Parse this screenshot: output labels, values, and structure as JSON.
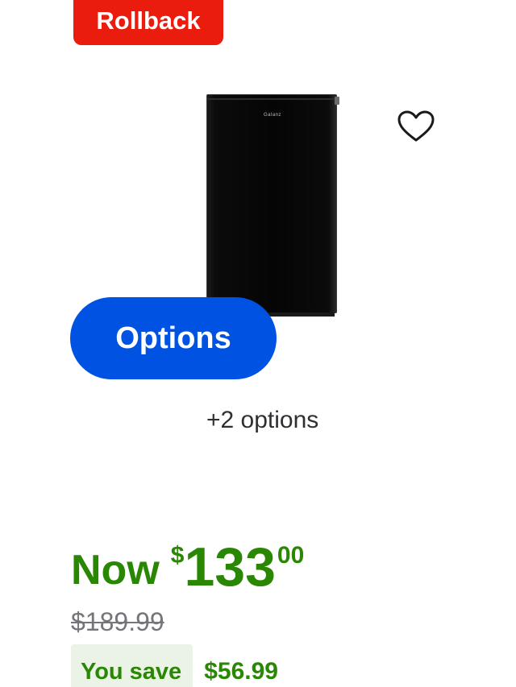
{
  "badge": {
    "label": "Rollback",
    "color": "#ea1c0e"
  },
  "product": {
    "image_icon": "mini-fridge-image",
    "brand_on_image": "Galanz",
    "wishlist_icon": "heart-outline-icon"
  },
  "options": {
    "button_label": "Options",
    "button_color": "#0053e2",
    "count_text": "+2 options"
  },
  "price": {
    "now_label": "Now",
    "currency": "$",
    "dollars": "133",
    "cents": "00",
    "was": "$189.99",
    "savings_label": "You save",
    "savings_amount": "$56.99",
    "accent_color": "#2a8703"
  }
}
